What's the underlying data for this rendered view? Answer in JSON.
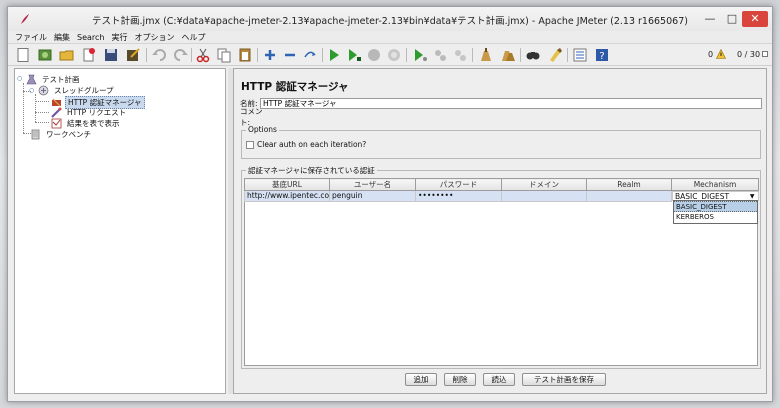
{
  "window": {
    "title": "テスト計画.jmx (C:¥data¥apache-jmeter-2.13¥apache-jmeter-2.13¥bin¥data¥テスト計画.jmx) - Apache JMeter (2.13 r1665067)",
    "minimize": "—",
    "maximize": "□",
    "close": "✕"
  },
  "menu": [
    "ファイル",
    "編集",
    "Search",
    "実行",
    "オプション",
    "ヘルプ"
  ],
  "toolbar": {
    "error_count": "0",
    "thread_count": "0 / 30"
  },
  "tree": {
    "root": "テスト計画",
    "thread_group": "スレッドグループ",
    "auth_manager": "HTTP 認証マネージャ",
    "http_request": "HTTP リクエスト",
    "results_table": "結果を表で表示",
    "workbench": "ワークベンチ"
  },
  "panel": {
    "title": "HTTP 認証マネージャ",
    "name_label": "名前:",
    "name_value": "HTTP 認証マネージャ",
    "comment_label": "コメント:",
    "comment_value": "",
    "options_title": "Options",
    "clear_auth_label": "Clear auth on each iteration?",
    "stored_title": "認証マネージャに保存されている認証"
  },
  "table": {
    "headers": [
      "基底URL",
      "ユーザー名",
      "パスワード",
      "ドメイン",
      "Realm",
      "Mechanism"
    ],
    "rows": [
      [
        "http://www.ipentec.com",
        "penguin",
        "••••••••",
        "",
        "",
        "BASIC_DIGEST"
      ]
    ]
  },
  "mechanism_dropdown": {
    "selected": "BASIC_DIGEST",
    "options": [
      "BASIC_DIGEST",
      "KERBEROS"
    ]
  },
  "buttons": {
    "add": "追加",
    "delete": "削除",
    "load": "読込",
    "save": "テスト計画を保存"
  },
  "colors": {
    "selection": "#c9d9ee",
    "row_highlight": "#d6e2f3",
    "close_button": "#d9453c"
  }
}
